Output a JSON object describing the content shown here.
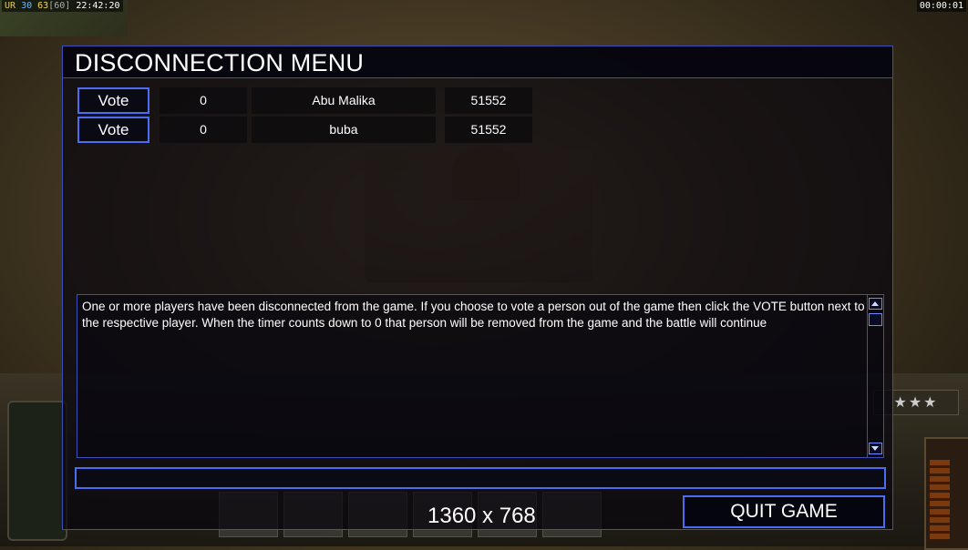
{
  "hud": {
    "top_left": {
      "ur": "UR",
      "v1": "30",
      "v2": "63",
      "v3": "[60]",
      "time": "22:42:20"
    },
    "top_right": "00:00:01"
  },
  "dialog": {
    "title": "DISCONNECTION MENU",
    "players": [
      {
        "vote_label": "Vote",
        "count": "0",
        "name": "Abu Malika",
        "port": "51552"
      },
      {
        "vote_label": "Vote",
        "count": "0",
        "name": "buba",
        "port": "51552"
      }
    ],
    "message": "One or more players have been disconnected from the game. If you choose to vote a person out of the game then click the VOTE button next to the respective player. When the timer counts down to 0 that person will be removed from the game and the battle will continue",
    "chat_input": {
      "value": "",
      "placeholder": ""
    },
    "resolution": "1360 x 768",
    "quit_label": "QUIT GAME"
  },
  "colors": {
    "accent": "#4a6cf0",
    "border": "#3c4fb8"
  },
  "hud_decor": {
    "stars": "★★★"
  }
}
